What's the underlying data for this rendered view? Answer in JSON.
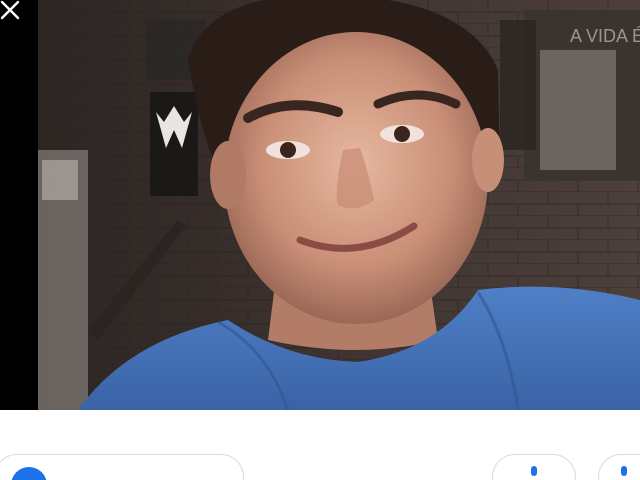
{
  "viewer": {
    "close_icon": "close-icon",
    "poster_text": "A VIDA É"
  },
  "actions": {
    "primary_label": "",
    "primary_icon": "google-lens-icon",
    "secondary_icon": "share-icon",
    "tertiary_icon": "more-icon"
  },
  "colors": {
    "accent": "#1a73e8",
    "border": "#dadce0",
    "viewer_bg": "#000000"
  }
}
